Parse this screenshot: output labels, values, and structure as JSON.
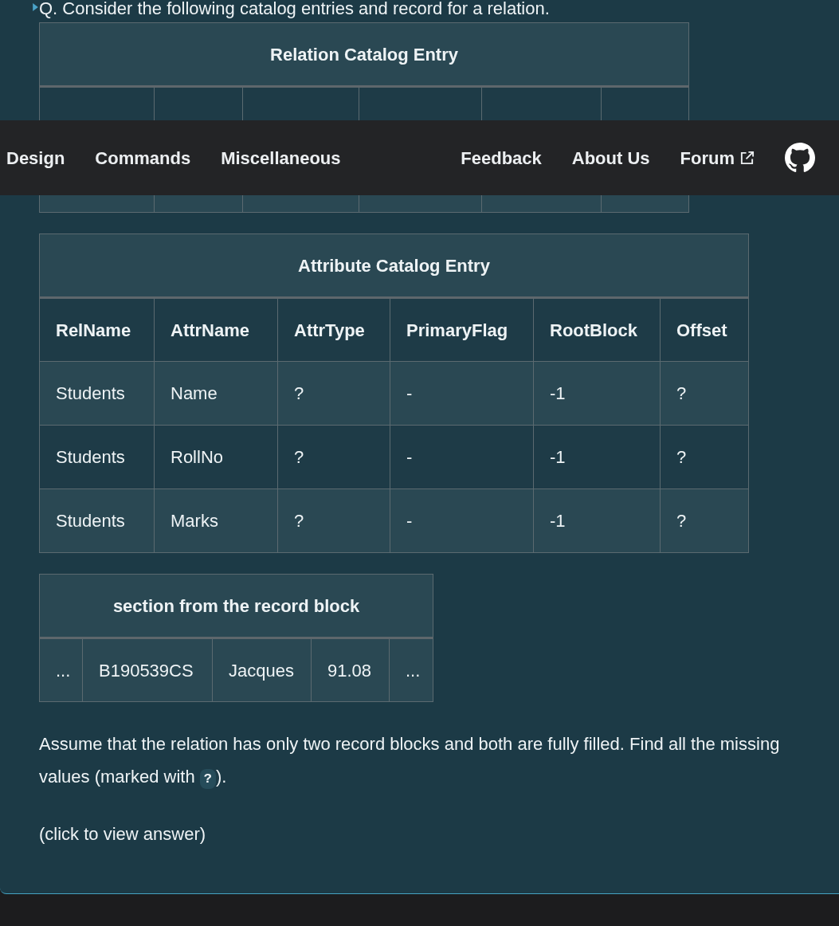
{
  "question": "Q. Consider the following catalog entries and record for a relation.",
  "tables": [
    {
      "title": "Relation Catalog Entry"
    },
    {
      "title": "Attribute Catalog Entry",
      "columns": [
        "RelName",
        "AttrName",
        "AttrType",
        "PrimaryFlag",
        "RootBlock",
        "Offset"
      ],
      "rows": [
        [
          "Students",
          "Name",
          "?",
          "-",
          "-1",
          "?"
        ],
        [
          "Students",
          "RollNo",
          "?",
          "-",
          "-1",
          "?"
        ],
        [
          "Students",
          "Marks",
          "?",
          "-",
          "-1",
          "?"
        ]
      ]
    },
    {
      "title": "section from the record block",
      "rows": [
        [
          "...",
          "B190539CS",
          "Jacques",
          "91.08",
          "..."
        ]
      ]
    }
  ],
  "paragraph": {
    "before": "Assume that the relation has only two record blocks and both are fully filled. Find all the missing values (marked with ",
    "code": "?",
    "after": ")."
  },
  "answer_toggle": "(click to view answer)",
  "navbar": {
    "left_items": [
      {
        "label": "Design",
        "external": false
      },
      {
        "label": "Commands",
        "external": false
      },
      {
        "label": "Miscellaneous",
        "external": false
      }
    ],
    "right_items": [
      {
        "label": "Feedback",
        "external": false
      },
      {
        "label": "About Us",
        "external": false
      },
      {
        "label": "Forum",
        "external": true
      }
    ]
  }
}
